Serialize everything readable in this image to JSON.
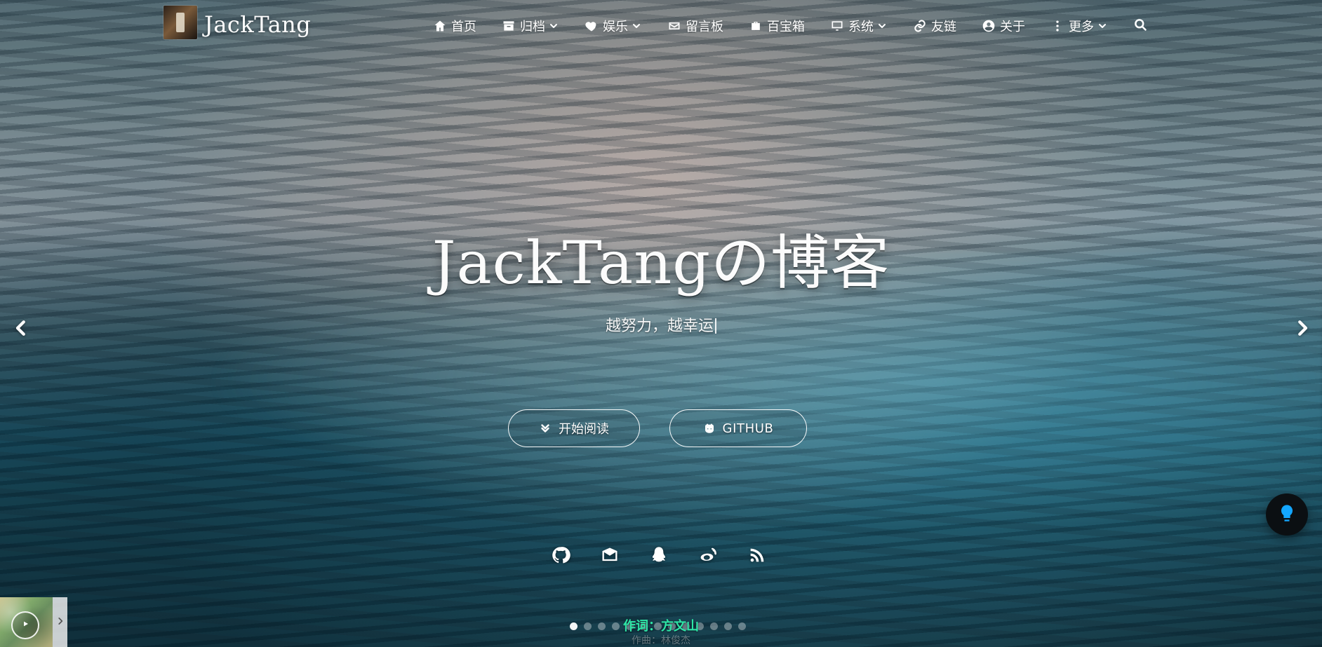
{
  "brand": {
    "name": "JackTang"
  },
  "nav": {
    "items": [
      {
        "label": "首页",
        "icon": "home-icon",
        "has_dropdown": false
      },
      {
        "label": "归档",
        "icon": "archive-icon",
        "has_dropdown": true
      },
      {
        "label": "娱乐",
        "icon": "heart-icon",
        "has_dropdown": true
      },
      {
        "label": "留言板",
        "icon": "mail-icon",
        "has_dropdown": false
      },
      {
        "label": "百宝箱",
        "icon": "suitcase-icon",
        "has_dropdown": false
      },
      {
        "label": "系统",
        "icon": "desktop-icon",
        "has_dropdown": true
      },
      {
        "label": "友链",
        "icon": "link-icon",
        "has_dropdown": false
      },
      {
        "label": "关于",
        "icon": "user-circle-icon",
        "has_dropdown": false
      },
      {
        "label": "更多",
        "icon": "more-vertical-icon",
        "has_dropdown": true
      }
    ],
    "search_icon": "search-icon"
  },
  "hero": {
    "title": "JackTangの博客",
    "subtitle": "越努力，越幸运",
    "buttons": {
      "start_reading": "开始阅读",
      "github": "GITHUB"
    }
  },
  "socials": [
    {
      "name": "github-icon"
    },
    {
      "name": "email-icon"
    },
    {
      "name": "qq-icon"
    },
    {
      "name": "weibo-icon"
    },
    {
      "name": "rss-icon"
    }
  ],
  "carousel": {
    "dots_total": 13,
    "active_index": 0
  },
  "player": {
    "lyrics": {
      "line1": "作词：方文山",
      "line2": "作曲：林俊杰"
    }
  },
  "colors": {
    "lyric_highlight": "#2ee6a7",
    "fab_background": "#0b0f12",
    "fab_icon": "#13a6ff"
  }
}
